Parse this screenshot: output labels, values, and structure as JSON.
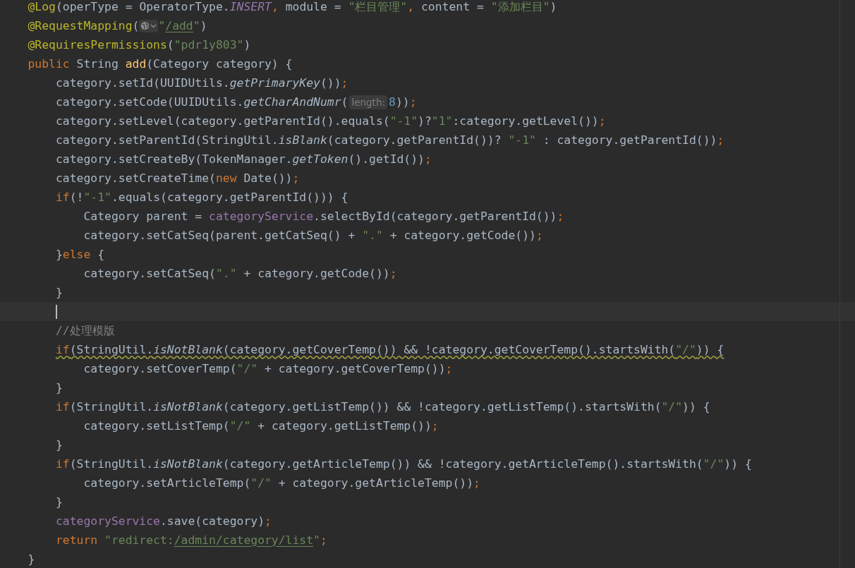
{
  "editor": {
    "lines": [
      {
        "tokens": [
          {
            "text": "    @Log",
            "kind": "annotation"
          },
          {
            "text": "(operType = OperatorType.",
            "kind": "plain"
          },
          {
            "text": "INSERT",
            "kind": "constant"
          },
          {
            "text": ", ",
            "kind": "keyword"
          },
          {
            "text": "module = ",
            "kind": "plain"
          },
          {
            "text": "\"栏目管理\"",
            "kind": "string"
          },
          {
            "text": ", ",
            "kind": "keyword"
          },
          {
            "text": "content = ",
            "kind": "plain"
          },
          {
            "text": "\"添加栏目\"",
            "kind": "string"
          },
          {
            "text": ")",
            "kind": "plain"
          }
        ]
      },
      {
        "tokens": [
          {
            "text": "    @RequestMapping",
            "kind": "annotation"
          },
          {
            "text": "(",
            "kind": "plain"
          },
          {
            "kind": "url-hint"
          },
          {
            "text": "\"",
            "kind": "string"
          },
          {
            "text": "/add",
            "kind": "link"
          },
          {
            "text": "\"",
            "kind": "string"
          },
          {
            "text": ")",
            "kind": "plain"
          }
        ]
      },
      {
        "tokens": [
          {
            "text": "    @RequiresPermissions",
            "kind": "annotation"
          },
          {
            "text": "(",
            "kind": "plain"
          },
          {
            "text": "\"pdr1y803\"",
            "kind": "string"
          },
          {
            "text": ")",
            "kind": "plain"
          }
        ]
      },
      {
        "tokens": [
          {
            "text": "    public ",
            "kind": "keyword"
          },
          {
            "text": "String ",
            "kind": "plain"
          },
          {
            "text": "add",
            "kind": "method"
          },
          {
            "text": "(Category category) {",
            "kind": "plain"
          }
        ]
      },
      {
        "tokens": [
          {
            "text": "        category.setId(UUIDUtils.",
            "kind": "plain"
          },
          {
            "text": "getPrimaryKey",
            "kind": "static"
          },
          {
            "text": "())",
            "kind": "plain"
          },
          {
            "text": ";",
            "kind": "keyword"
          }
        ]
      },
      {
        "tokens": [
          {
            "text": "        category.setCode(UUIDUtils.",
            "kind": "plain"
          },
          {
            "text": "getCharAndNumr",
            "kind": "static"
          },
          {
            "text": "(",
            "kind": "plain"
          },
          {
            "text": "length:",
            "kind": "hint"
          },
          {
            "text": "8",
            "kind": "number"
          },
          {
            "text": "))",
            "kind": "plain"
          },
          {
            "text": ";",
            "kind": "keyword"
          }
        ]
      },
      {
        "tokens": [
          {
            "text": "        category.setLevel(category.getParentId().equals(",
            "kind": "plain"
          },
          {
            "text": "\"-1\"",
            "kind": "string"
          },
          {
            "text": ")?",
            "kind": "plain"
          },
          {
            "text": "\"1\"",
            "kind": "string"
          },
          {
            "text": ":category.getLevel())",
            "kind": "plain"
          },
          {
            "text": ";",
            "kind": "keyword"
          }
        ]
      },
      {
        "tokens": [
          {
            "text": "        category.setParentId(StringUtil.",
            "kind": "plain"
          },
          {
            "text": "isBlank",
            "kind": "static"
          },
          {
            "text": "(category.getParentId())? ",
            "kind": "plain"
          },
          {
            "text": "\"-1\"",
            "kind": "string"
          },
          {
            "text": " : category.getParentId())",
            "kind": "plain"
          },
          {
            "text": ";",
            "kind": "keyword"
          }
        ]
      },
      {
        "tokens": [
          {
            "text": "        category.setCreateBy(TokenManager.",
            "kind": "plain"
          },
          {
            "text": "getToken",
            "kind": "static"
          },
          {
            "text": "().getId())",
            "kind": "plain"
          },
          {
            "text": ";",
            "kind": "keyword"
          }
        ]
      },
      {
        "tokens": [
          {
            "text": "        category.setCreateTime(",
            "kind": "plain"
          },
          {
            "text": "new ",
            "kind": "keyword"
          },
          {
            "text": "Date())",
            "kind": "plain"
          },
          {
            "text": ";",
            "kind": "keyword"
          }
        ]
      },
      {
        "tokens": [
          {
            "text": "        if",
            "kind": "keyword"
          },
          {
            "text": "(!",
            "kind": "plain"
          },
          {
            "text": "\"-1\"",
            "kind": "string"
          },
          {
            "text": ".equals(category.getParentId())) {",
            "kind": "plain"
          }
        ]
      },
      {
        "tokens": [
          {
            "text": "            Category parent = ",
            "kind": "plain"
          },
          {
            "text": "categoryService",
            "kind": "field"
          },
          {
            "text": ".selectById(category.getParentId())",
            "kind": "plain"
          },
          {
            "text": ";",
            "kind": "keyword"
          }
        ]
      },
      {
        "tokens": [
          {
            "text": "            category.setCatSeq(parent.getCatSeq() + ",
            "kind": "plain"
          },
          {
            "text": "\".\"",
            "kind": "string"
          },
          {
            "text": " + category.getCode())",
            "kind": "plain"
          },
          {
            "text": ";",
            "kind": "keyword"
          }
        ]
      },
      {
        "tokens": [
          {
            "text": "        }",
            "kind": "plain"
          },
          {
            "text": "else ",
            "kind": "keyword"
          },
          {
            "text": "{",
            "kind": "plain"
          }
        ]
      },
      {
        "tokens": [
          {
            "text": "            category.setCatSeq(",
            "kind": "plain"
          },
          {
            "text": "\".\"",
            "kind": "string"
          },
          {
            "text": " + category.getCode())",
            "kind": "plain"
          },
          {
            "text": ";",
            "kind": "keyword"
          }
        ]
      },
      {
        "tokens": [
          {
            "text": "        }",
            "kind": "plain"
          }
        ]
      },
      {
        "current": true
      },
      {
        "tokens": [
          {
            "text": "        //处理模版",
            "kind": "comment"
          }
        ]
      },
      {
        "warning": true,
        "tokens": [
          {
            "text": "        if",
            "kind": "keyword"
          },
          {
            "text": "(StringUtil.",
            "kind": "plain"
          },
          {
            "text": "isNotBlank",
            "kind": "static"
          },
          {
            "text": "(category.getCoverTemp()) && !category.getCoverTemp().startsWith(",
            "kind": "plain"
          },
          {
            "text": "\"/\"",
            "kind": "string"
          },
          {
            "text": ")) {",
            "kind": "plain"
          }
        ]
      },
      {
        "tokens": [
          {
            "text": "            category.setCoverTemp(",
            "kind": "plain"
          },
          {
            "text": "\"/\"",
            "kind": "string"
          },
          {
            "text": " + category.getCoverTemp())",
            "kind": "plain"
          },
          {
            "text": ";",
            "kind": "keyword"
          }
        ]
      },
      {
        "tokens": [
          {
            "text": "        }",
            "kind": "plain"
          }
        ]
      },
      {
        "tokens": [
          {
            "text": "        if",
            "kind": "keyword"
          },
          {
            "text": "(StringUtil.",
            "kind": "plain"
          },
          {
            "text": "isNotBlank",
            "kind": "static"
          },
          {
            "text": "(category.getListTemp()) && !category.getListTemp().startsWith(",
            "kind": "plain"
          },
          {
            "text": "\"/\"",
            "kind": "string"
          },
          {
            "text": ")) {",
            "kind": "plain"
          }
        ]
      },
      {
        "tokens": [
          {
            "text": "            category.setListTemp(",
            "kind": "plain"
          },
          {
            "text": "\"/\"",
            "kind": "string"
          },
          {
            "text": " + category.getListTemp())",
            "kind": "plain"
          },
          {
            "text": ";",
            "kind": "keyword"
          }
        ]
      },
      {
        "tokens": [
          {
            "text": "        }",
            "kind": "plain"
          }
        ]
      },
      {
        "tokens": [
          {
            "text": "        if",
            "kind": "keyword"
          },
          {
            "text": "(StringUtil.",
            "kind": "plain"
          },
          {
            "text": "isNotBlank",
            "kind": "static"
          },
          {
            "text": "(category.getArticleTemp()) && !category.getArticleTemp().startsWith(",
            "kind": "plain"
          },
          {
            "text": "\"/\"",
            "kind": "string"
          },
          {
            "text": ")) {",
            "kind": "plain"
          }
        ]
      },
      {
        "tokens": [
          {
            "text": "            category.setArticleTemp(",
            "kind": "plain"
          },
          {
            "text": "\"/\"",
            "kind": "string"
          },
          {
            "text": " + category.getArticleTemp())",
            "kind": "plain"
          },
          {
            "text": ";",
            "kind": "keyword"
          }
        ]
      },
      {
        "tokens": [
          {
            "text": "        }",
            "kind": "plain"
          }
        ]
      },
      {
        "tokens": [
          {
            "text": "        categoryService",
            "kind": "field"
          },
          {
            "text": ".save(category)",
            "kind": "plain"
          },
          {
            "text": ";",
            "kind": "keyword"
          }
        ]
      },
      {
        "tokens": [
          {
            "text": "        return ",
            "kind": "keyword"
          },
          {
            "text": "\"redirect:",
            "kind": "string"
          },
          {
            "text": "/admin/category/list",
            "kind": "link"
          },
          {
            "text": "\"",
            "kind": "string"
          },
          {
            "text": ";",
            "kind": "keyword"
          }
        ]
      },
      {
        "tokens": [
          {
            "text": "    }",
            "kind": "plain"
          }
        ]
      }
    ]
  }
}
